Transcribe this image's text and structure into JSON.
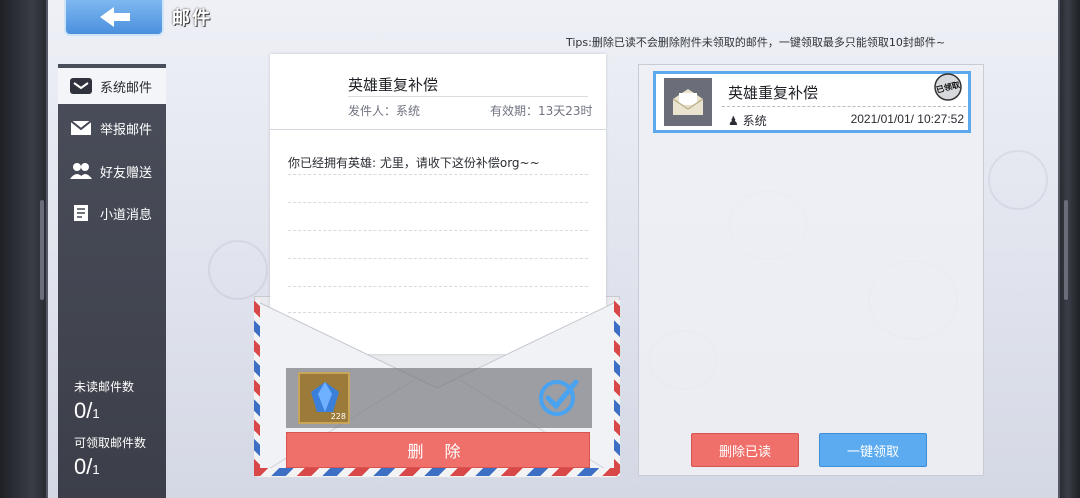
{
  "header": {
    "title": "邮件",
    "tips": "Tips:删除已读不会删除附件未领取的邮件，一键领取最多只能领取10封邮件~"
  },
  "sidebar": {
    "items": [
      {
        "label": "系统邮件",
        "icon": "system-mail-icon",
        "active": true
      },
      {
        "label": "举报邮件",
        "icon": "envelope-icon",
        "active": false
      },
      {
        "label": "好友赠送",
        "icon": "friends-icon",
        "active": false
      },
      {
        "label": "小道消息",
        "icon": "news-icon",
        "active": false
      }
    ],
    "stats": [
      {
        "label": "未读邮件数",
        "value": "0",
        "max": "1"
      },
      {
        "label": "可领取邮件数",
        "value": "0",
        "max": "1"
      }
    ]
  },
  "letter": {
    "title": "英雄重复补偿",
    "sender": "发件人：系统",
    "validity": "有效期：13天23时",
    "body": "你已经拥有英雄: 尤里，请收下这份补偿org~~",
    "attachment": {
      "icon": "blue-crystal-icon",
      "count": "228",
      "claimed": true
    },
    "delete_label": "删 除"
  },
  "mail_list": [
    {
      "title": "英雄重复补偿",
      "sender": "系统",
      "time": "2021/01/01/ 10:27:52",
      "stamp": "已领取",
      "selected": true
    }
  ],
  "actions": {
    "delete_read": "删除已读",
    "claim_all": "一键领取"
  },
  "colors": {
    "accent_blue": "#5caaf0",
    "danger_red": "#ef6f6a",
    "sidebar_bg": "#444753"
  }
}
